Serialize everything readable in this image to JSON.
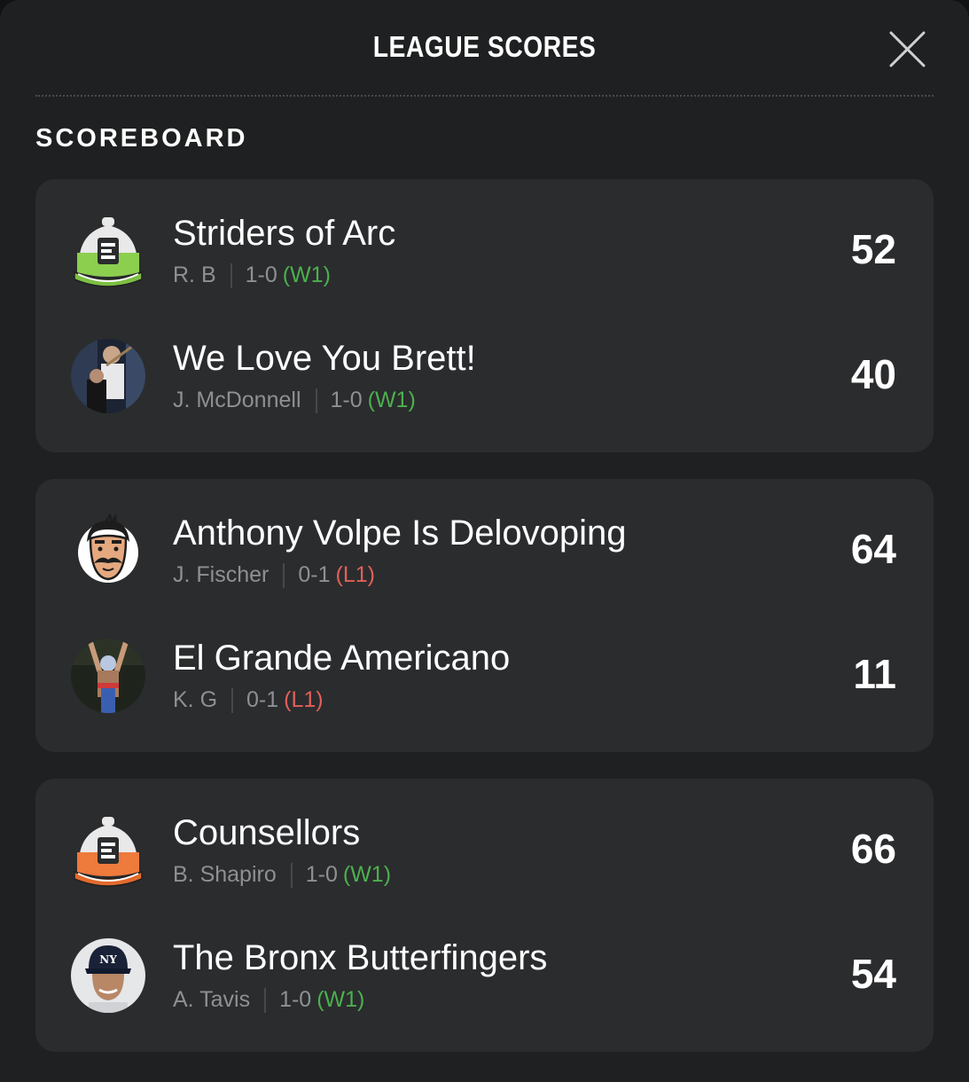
{
  "header": {
    "title": "LEAGUE SCORES",
    "close_icon": "close-icon"
  },
  "section": {
    "title": "SCOREBOARD"
  },
  "matchups": [
    {
      "teams": [
        {
          "name": "Striders of Arc",
          "owner": "R. B",
          "record": "1-0",
          "streak": "(W1)",
          "streak_type": "win",
          "score": "52",
          "avatar": "espn-cap-green-logo"
        },
        {
          "name": "We Love You Brett!",
          "owner": "J. McDonnell",
          "record": "1-0",
          "streak": "(W1)",
          "streak_type": "win",
          "score": "40",
          "avatar": "photo-avatar"
        }
      ]
    },
    {
      "teams": [
        {
          "name": "Anthony Volpe Is Delovoping",
          "owner": "J. Fischer",
          "record": "0-1",
          "streak": "(L1)",
          "streak_type": "loss",
          "score": "64",
          "avatar": "mustache-man-cartoon"
        },
        {
          "name": "El Grande Americano",
          "owner": "K. G",
          "record": "0-1",
          "streak": "(L1)",
          "streak_type": "loss",
          "score": "11",
          "avatar": "photo-avatar"
        }
      ]
    },
    {
      "teams": [
        {
          "name": "Counsellors",
          "owner": "B. Shapiro",
          "record": "1-0",
          "streak": "(W1)",
          "streak_type": "win",
          "score": "66",
          "avatar": "espn-cap-orange-logo"
        },
        {
          "name": "The Bronx Butterfingers",
          "owner": "A. Tavis",
          "record": "1-0",
          "streak": "(W1)",
          "streak_type": "win",
          "score": "54",
          "avatar": "ny-cap-player-photo"
        }
      ]
    }
  ],
  "colors": {
    "background": "#1f2021",
    "card": "#2b2c2e",
    "win": "#4cb04e",
    "loss": "#e0605a",
    "muted": "#8e9093"
  }
}
